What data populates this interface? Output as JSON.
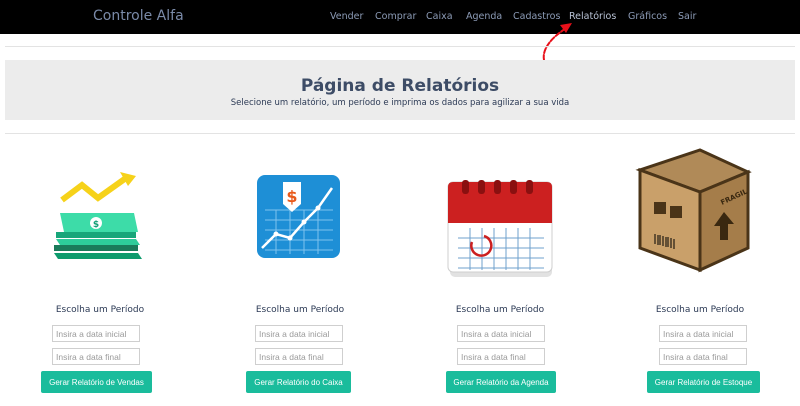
{
  "navbar": {
    "brand": "Controle Alfa",
    "items": [
      {
        "label": "Vender"
      },
      {
        "label": "Comprar"
      },
      {
        "label": "Caixa"
      },
      {
        "label": "Agenda"
      },
      {
        "label": "Cadastros"
      },
      {
        "label": "Relatórios",
        "active": true
      },
      {
        "label": "Gráficos"
      },
      {
        "label": "Sair"
      }
    ]
  },
  "header": {
    "title": "Página de Relatórios",
    "subtitle": "Selecione um relatório, um período e imprima os dados para agilizar a sua vida"
  },
  "reports": [
    {
      "icon": "money-growth-icon",
      "period_label": "Escolha um Período",
      "start_placeholder": "Insira a data inicial",
      "end_placeholder": "Insira a data final",
      "button": "Gerar Relatório de Vendas"
    },
    {
      "icon": "financial-chart-icon",
      "period_label": "Escolha um Período",
      "start_placeholder": "Insira a data inicial",
      "end_placeholder": "Insira a data final",
      "button": "Gerar Relatório do Caixa"
    },
    {
      "icon": "calendar-icon",
      "period_label": "Escolha um Período",
      "start_placeholder": "Insira a data inicial",
      "end_placeholder": "Insira a data final",
      "button": "Gerar Relatório da Agenda"
    },
    {
      "icon": "fragile-box-icon",
      "period_label": "Escolha um Período",
      "start_placeholder": "Insira a data inicial",
      "end_placeholder": "Insira a data final",
      "button": "Gerar Relatório de Estoque"
    }
  ],
  "box_text": "FRAGIL",
  "colors": {
    "navbar": "#000000",
    "accent_button": "#1abc9c",
    "header_bg": "#ececec",
    "annotation_arrow": "#e8101a"
  }
}
